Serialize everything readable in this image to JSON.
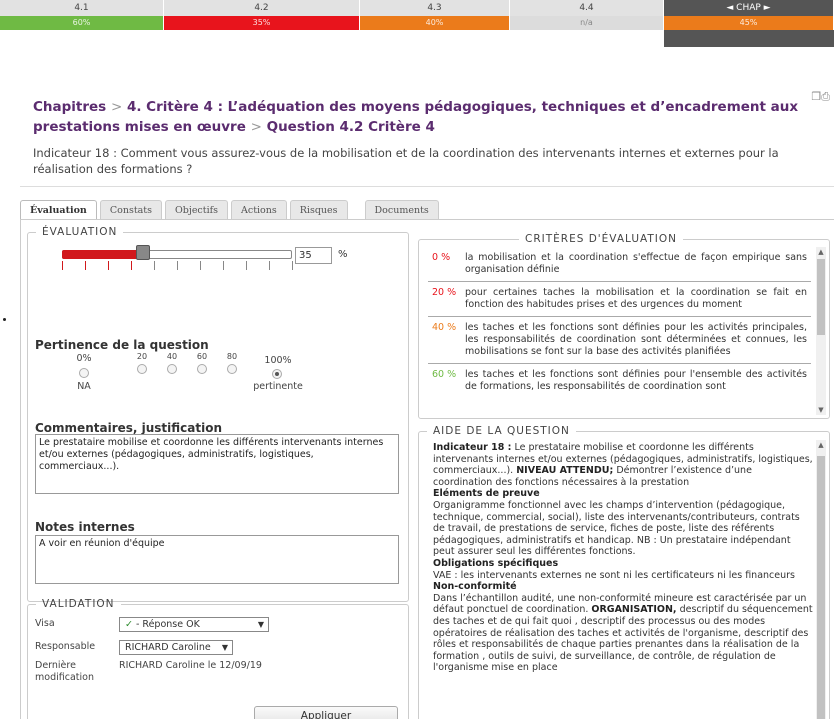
{
  "progress": {
    "headers": [
      "4.1",
      "4.2",
      "4.3",
      "4.4",
      "◄ CHAP ►"
    ],
    "values": [
      "60%",
      "35%",
      "40%",
      "n/a",
      "45%"
    ],
    "colors": [
      "#6fba44",
      "#e8141c",
      "#eb7b1b",
      "#dcdcdc",
      "#eb7b1b"
    ]
  },
  "breadcrumb": {
    "root": "Chapitres",
    "sep": ">",
    "chapter": "4. Critère 4 : L’adéquation des moyens pédagogiques, techniques et d’encadrement aux prestations mises en œuvre",
    "question": "Question 4.2 Critère 4"
  },
  "indicator": "Indicateur 18 : Comment vous assurez-vous de la mobilisation et de la coordination des intervenants internes et externes pour la réalisation des formations ?",
  "tabs": [
    "Évaluation",
    "Constats",
    "Objectifs",
    "Actions",
    "Risques",
    "Documents"
  ],
  "evaluation": {
    "legend": "ÉVALUATION",
    "slider_value": 35,
    "slider_text": "35",
    "pct_sign": "%",
    "pertinence_title": "Pertinence de la question",
    "radios": [
      {
        "top": "0%",
        "bottom": "NA",
        "checked": false
      },
      {
        "top": "20",
        "bottom": "",
        "checked": false
      },
      {
        "top": "40",
        "bottom": "",
        "checked": false
      },
      {
        "top": "60",
        "bottom": "",
        "checked": false
      },
      {
        "top": "80",
        "bottom": "",
        "checked": false
      },
      {
        "top": "100%",
        "bottom": "pertinente",
        "checked": true
      }
    ],
    "comments_title": "Commentaires, justification",
    "comments_value": "Le prestataire mobilise et coordonne les différents intervenants internes et/ou externes (pédagogiques, administratifs, logistiques, commerciaux...).",
    "notes_title": "Notes internes",
    "notes_value": "A voir en réunion d'équipe"
  },
  "validation": {
    "legend": "VALIDATION",
    "visa_label": "Visa",
    "visa_check": "✓",
    "visa_value": "- Réponse OK",
    "resp_label": "Responsable",
    "resp_value": "RICHARD Caroline",
    "last_label": "Dernière modification",
    "last_value": "RICHARD Caroline le 12/09/19",
    "apply": "Appliquer"
  },
  "criteria": {
    "legend": "CRITÈRES D'ÉVALUATION",
    "items": [
      {
        "pct": "0 %",
        "color": "#e8141c",
        "text": "la mobilisation et la coordination s'effectue de façon empirique sans organisation définie"
      },
      {
        "pct": "20 %",
        "color": "#e8141c",
        "text": "pour certaines taches la mobilisation et la coordination se fait en fonction des habitudes prises et des urgences du moment"
      },
      {
        "pct": "40 %",
        "color": "#eb7b1b",
        "text": "les taches et les fonctions sont définies pour les activités principales, les responsabilités de coordination sont déterminées et connues, les mobilisations se font sur la base des activités planifiées"
      },
      {
        "pct": "60 %",
        "color": "#6fba44",
        "text": "les taches et les fonctions sont définies pour l'ensemble des activités de formations, les responsabilités de coordination sont"
      }
    ]
  },
  "aide": {
    "legend": "AIDE DE LA QUESTION",
    "p1_label": "Indicateur 18 :",
    "p1_text": "Le prestataire mobilise et coordonne les différents intervenants internes et/ou externes (pédagogiques, administratifs, logistiques, commerciaux...).",
    "p1_bold": "NIVEAU ATTENDU;",
    "p1_text2": "Démontrer l’existence d’une coordination des fonctions nécessaires à la prestation",
    "h2": "Eléments de preuve",
    "p2": "Organigramme fonctionnel avec les champs d’intervention (pédagogique, technique, commercial, social), liste des intervenants/contributeurs, contrats de travail, de prestations de service, fiches de poste, liste des référents pédagogiques, administratifs et handicap. NB : Un prestataire indépendant peut assurer seul les différentes fonctions.",
    "h3": "Obligations spécifiques",
    "p3": "VAE : les intervenants externes ne sont ni les certificateurs ni les financeurs",
    "h4": "Non-conformité",
    "p4": "Dans l’échantillon audité, une non-conformité mineure est caractérisée par un défaut ponctuel de coordination.",
    "p4_bold": "ORGANISATION,",
    "p4_text2": "descriptif du séquencement des taches et de qui fait quoi , descriptif des processus ou des modes opératoires de réalisation des taches et activités de l'organisme, descriptif des rôles et responsabilités de chaque parties prenantes dans la réalisation de la formation , outils de suivi, de surveillance, de contrôle, de régulation de l'organisme mise en place"
  }
}
